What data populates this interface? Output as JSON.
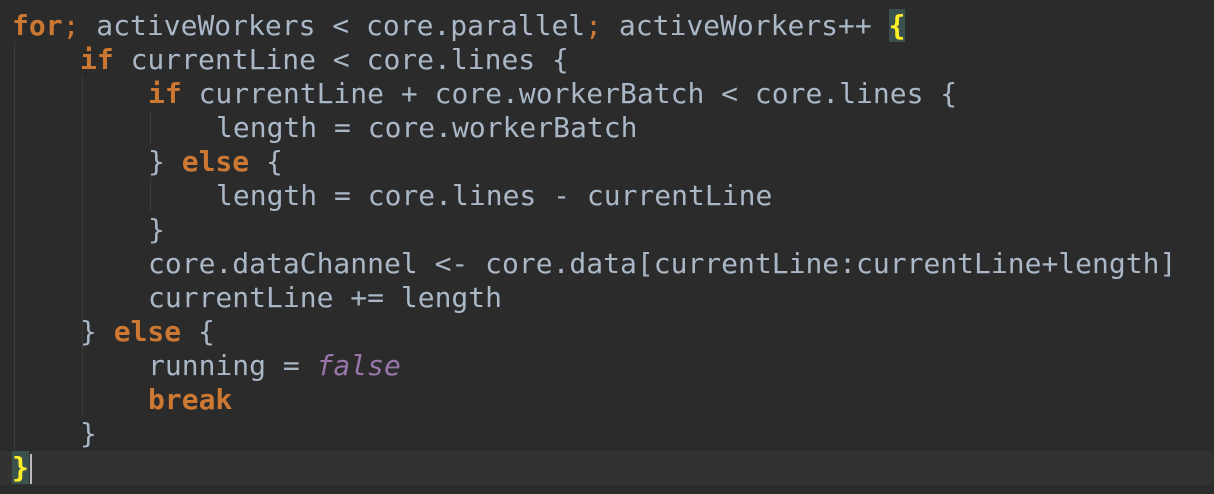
{
  "editor": {
    "line1": {
      "kw_for": "for",
      "semi1": ";",
      "cond": " activeWorkers < core.parallel",
      "semi2": ";",
      "post": " activeWorkers++ ",
      "brace": "{"
    },
    "line2": {
      "kw_if": "if",
      "rest": " currentLine < core.lines {"
    },
    "line3": {
      "kw_if": "if",
      "rest": " currentLine + core.workerBatch < core.lines {"
    },
    "line4": {
      "text": "length = core.workerBatch"
    },
    "line5": {
      "open": "} ",
      "kw_else": "else",
      "rest": " {"
    },
    "line6": {
      "text": "length = core.lines - currentLine"
    },
    "line7": {
      "text": "}"
    },
    "line8": {
      "text": "core.dataChannel <- core.data[currentLine:currentLine+length]"
    },
    "line9": {
      "text": "currentLine += length"
    },
    "line10": {
      "open": "} ",
      "kw_else": "else",
      "rest": " {"
    },
    "line11": {
      "pre": "running = ",
      "lit": "false"
    },
    "line12": {
      "kw_break": "break"
    },
    "line13": {
      "text": "}"
    },
    "line14": {
      "brace": "}"
    }
  },
  "colors": {
    "background": "#2b2b2b",
    "caret_row": "#323232",
    "text": "#a9b7c6",
    "keyword": "#cc7832",
    "literal": "#9876aa",
    "brace_match_fg": "#ffef28",
    "brace_match_bg": "#3b514d"
  }
}
